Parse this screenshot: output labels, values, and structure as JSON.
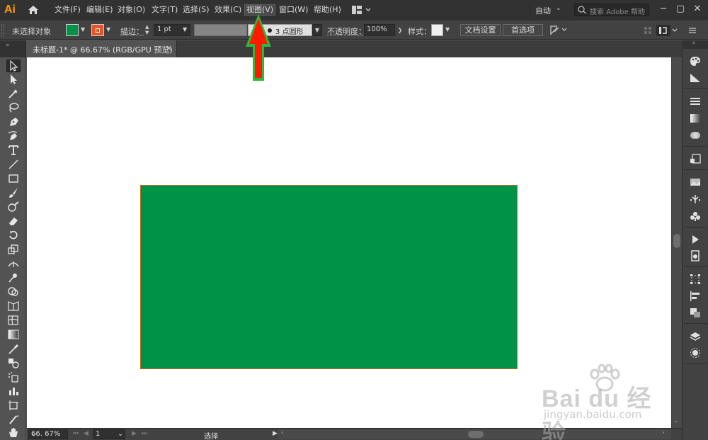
{
  "menubar": {
    "app_logo": "Ai",
    "items": [
      "文件(F)",
      "编辑(E)",
      "对象(O)",
      "文字(T)",
      "选择(S)",
      "效果(C)",
      "视图(V)",
      "窗口(W)",
      "帮助(H)"
    ],
    "active_item": "视图(V)",
    "workspace": "自动",
    "search_placeholder": "搜索 Adobe 帮助",
    "icons": [
      "home-icon",
      "arrange-documents-icon",
      "search-icon",
      "minimize-icon",
      "maximize-icon",
      "close-icon"
    ]
  },
  "controlbar": {
    "selection_status": "未选择对象",
    "fill_color": "#009245",
    "stroke_color": "#e8542a",
    "stroke_label": "描边：",
    "stroke_weight": "1 pt",
    "brush_definition": "3 点圆形",
    "opacity_label": "不透明度：",
    "opacity_value": "100%",
    "style_label": "样式：",
    "document_setup": "文档设置",
    "preferences": "首选项"
  },
  "tab": {
    "title": "未标题-1* @ 66.67% (RGB/GPU 预览)",
    "close": "×"
  },
  "canvas": {
    "background": "#ffffff",
    "rectangle_fill": "#009245",
    "rectangle_stroke": "#c86a1e"
  },
  "statusbar": {
    "zoom": "66. 67%",
    "page": "1",
    "status": "选择"
  },
  "annotation": {
    "arrow_color": "#ff0000",
    "arrow_outline": "#2db83d"
  },
  "watermark": {
    "brand": "Bai du 经验",
    "url": "jingyan.baidu.com"
  },
  "tools": [
    "selection-tool-icon",
    "direct-selection-tool-icon",
    "magic-wand-tool-icon",
    "lasso-tool-icon",
    "pen-tool-icon",
    "curvature-tool-icon",
    "type-tool-icon",
    "line-tool-icon",
    "rectangle-tool-icon",
    "paintbrush-tool-icon",
    "shaper-tool-icon",
    "eraser-tool-icon",
    "rotate-tool-icon",
    "scale-tool-icon",
    "width-tool-icon",
    "puppet-warp-tool-icon",
    "shape-builder-tool-icon",
    "perspective-grid-tool-icon",
    "mesh-tool-icon",
    "gradient-tool-icon",
    "eyedropper-tool-icon",
    "blend-tool-icon",
    "symbol-sprayer-tool-icon",
    "column-graph-tool-icon",
    "artboard-tool-icon",
    "slice-tool-icon",
    "hand-tool-icon"
  ],
  "right_panels": [
    "color-panel-icon",
    "color-guide-panel-icon",
    "stroke-panel-icon",
    "gradient-panel-icon",
    "transparency-panel-icon",
    "artboards-panel-icon",
    "image-trace-panel-icon",
    "symbols-panel-icon",
    "brushes-panel-icon",
    "actions-panel-icon",
    "links-panel-icon",
    "transform-panel-icon",
    "align-panel-icon",
    "pathfinder-panel-icon",
    "layers-panel-icon",
    "appearance-panel-icon"
  ]
}
